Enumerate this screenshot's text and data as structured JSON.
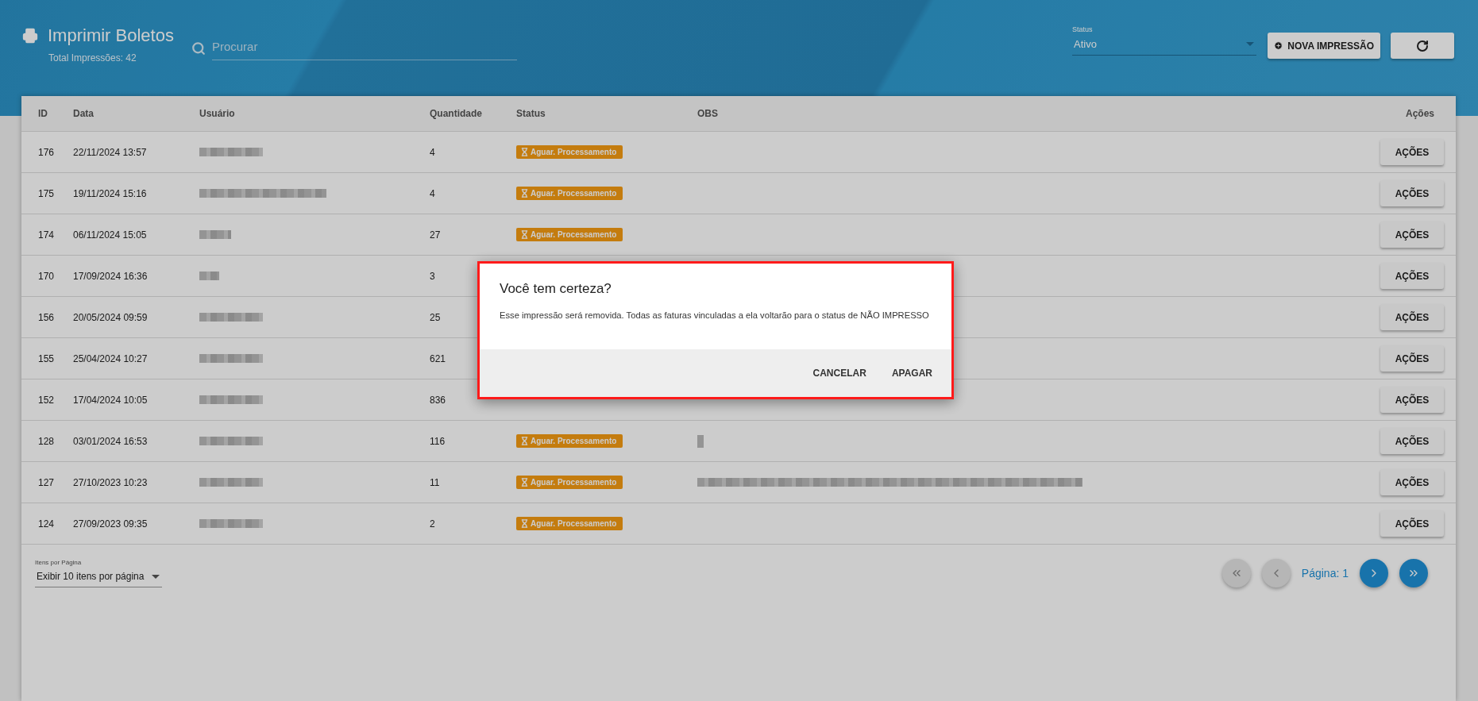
{
  "header": {
    "title": "Imprimir Boletos",
    "subtitle": "Total Impressões: 42",
    "search": {
      "placeholder": "Procurar"
    },
    "status_filter": {
      "label": "Status",
      "value": "Ativo"
    },
    "new_button": "NOVA IMPRESSÃO"
  },
  "table": {
    "columns": [
      "ID",
      "Data",
      "Usuário",
      "Quantidade",
      "Status",
      "OBS",
      "Ações"
    ],
    "rows": [
      {
        "id": "176",
        "date": "22/11/2024 13:57",
        "quantity": "4",
        "status": "Aguar. Processamento",
        "action": "AÇÕES"
      },
      {
        "id": "175",
        "date": "19/11/2024 15:16",
        "quantity": "4",
        "status": "Aguar. Processamento",
        "action": "AÇÕES"
      },
      {
        "id": "174",
        "date": "06/11/2024 15:05",
        "quantity": "27",
        "status": "Aguar. Processamento",
        "action": "AÇÕES"
      },
      {
        "id": "170",
        "date": "17/09/2024 16:36",
        "quantity": "3",
        "action": "AÇÕES"
      },
      {
        "id": "156",
        "date": "20/05/2024 09:59",
        "quantity": "25",
        "action": "AÇÕES"
      },
      {
        "id": "155",
        "date": "25/04/2024 10:27",
        "quantity": "621",
        "action": "AÇÕES"
      },
      {
        "id": "152",
        "date": "17/04/2024 10:05",
        "quantity": "836",
        "action": "AÇÕES"
      },
      {
        "id": "128",
        "date": "03/01/2024 16:53",
        "quantity": "116",
        "status": "Aguar. Processamento",
        "obs": {
          "kind": "short"
        },
        "action": "AÇÕES"
      },
      {
        "id": "127",
        "date": "27/10/2023 10:23",
        "quantity": "11",
        "status": "Aguar. Processamento",
        "obs": {
          "kind": "long"
        },
        "action": "AÇÕES"
      },
      {
        "id": "124",
        "date": "27/09/2023 09:35",
        "quantity": "2",
        "status": "Aguar. Processamento",
        "action": "AÇÕES"
      }
    ]
  },
  "pagination": {
    "per_page_label": "Itens por Página",
    "per_page_value": "Exibir 10 itens por página",
    "page": "Página: 1",
    "buttons": [
      {
        "kind": "first",
        "disabled": true
      },
      {
        "kind": "prev",
        "disabled": true
      },
      {
        "kind": "next",
        "disabled": false
      },
      {
        "kind": "last",
        "disabled": false
      }
    ]
  },
  "dialog": {
    "title": "Você tem certeza?",
    "message": "Esse impressão será removida. Todas as faturas vinculadas a ela voltarão para o status de NÃO IMPRESSO",
    "buttons": [
      "CANCELAR",
      "APAGAR"
    ]
  }
}
